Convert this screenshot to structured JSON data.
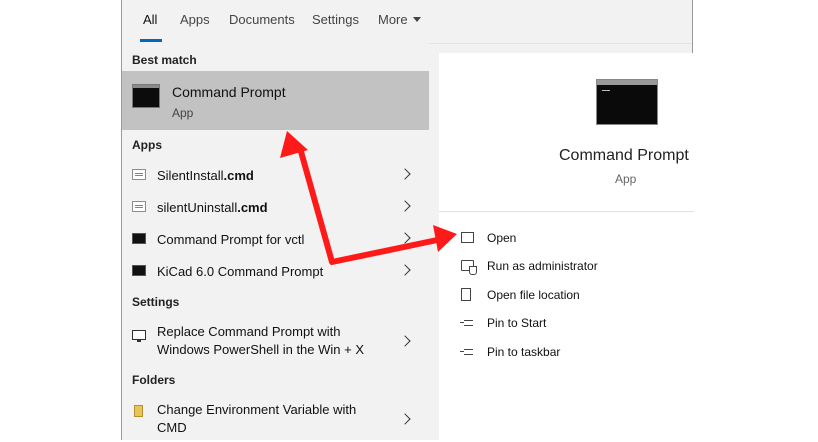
{
  "tabs": [
    "All",
    "Apps",
    "Documents",
    "Settings",
    "More"
  ],
  "best_match": {
    "heading": "Best match",
    "title": "Command Prompt",
    "subtitle": "App"
  },
  "apps": {
    "heading": "Apps",
    "items": [
      {
        "prefix": "SilentInstall",
        "bold": ".cmd",
        "icon": "script-icon"
      },
      {
        "prefix": "silentUninstall",
        "bold": ".cmd",
        "icon": "script-icon"
      },
      {
        "prefix": "Command Prompt for vctl",
        "bold": "",
        "icon": "cmd-icon"
      },
      {
        "prefix": "KiCad 6.0 Command Prompt",
        "bold": "",
        "icon": "cmd-icon"
      }
    ]
  },
  "settings": {
    "heading": "Settings",
    "item_line1": "Replace Command Prompt with",
    "item_line2": "Windows PowerShell in the Win + X"
  },
  "folders": {
    "heading": "Folders",
    "item_line1": "Change Environment Variable with",
    "item_line2": "CMD"
  },
  "detail": {
    "title": "Command Prompt",
    "subtitle": "App",
    "actions": [
      {
        "label": "Open",
        "icon": "open-icon"
      },
      {
        "label": "Run as administrator",
        "icon": "admin-shield-icon"
      },
      {
        "label": "Open file location",
        "icon": "file-location-icon"
      },
      {
        "label": "Pin to Start",
        "icon": "pin-icon"
      },
      {
        "label": "Pin to taskbar",
        "icon": "pin-icon"
      }
    ]
  },
  "colors": {
    "accent": "#0067c0",
    "selected_bg": "#c2c2c2",
    "annotation_arrow": "#ff1a1a"
  }
}
